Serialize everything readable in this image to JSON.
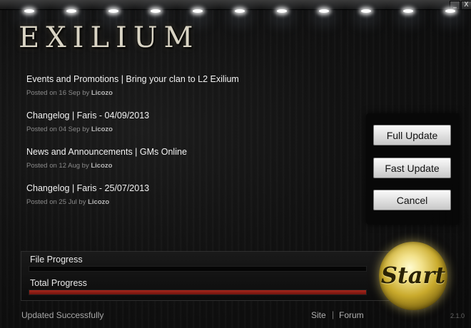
{
  "window": {
    "minimize_label": "_",
    "close_label": "X"
  },
  "logo": {
    "text": "EXILIUM"
  },
  "news": [
    {
      "title": "Events and Promotions | Bring your clan to L2 Exilium",
      "date": "Posted on 16 Sep",
      "by": "by",
      "author": "Licozo"
    },
    {
      "title": "Changelog | Faris - 04/09/2013",
      "date": "Posted on 04 Sep",
      "by": "by",
      "author": "Licozo"
    },
    {
      "title": "News and Announcements | GMs Online",
      "date": "Posted on 12 Aug",
      "by": "by",
      "author": "Licozo"
    },
    {
      "title": "Changelog | Faris - 25/07/2013",
      "date": "Posted on 25 Jul",
      "by": "by",
      "author": "Licozo"
    }
  ],
  "actions": {
    "full_update": "Full Update",
    "fast_update": "Fast Update",
    "cancel": "Cancel"
  },
  "progress": {
    "file": {
      "label": "File Progress",
      "value": 0.0
    },
    "total": {
      "label": "Total Progress",
      "value": 1.0
    }
  },
  "start": {
    "label": "Start"
  },
  "footer": {
    "status": "Updated Successfully",
    "site": "Site",
    "separator": "|",
    "forum": "Forum",
    "version": "2.1.0"
  },
  "colors": {
    "background": "#121212",
    "total_progress_fill": "#a8261c",
    "file_progress_fill": "#3a3a3a",
    "start_gold": "#c9aa2c",
    "button_face": "#e6e6e6"
  }
}
